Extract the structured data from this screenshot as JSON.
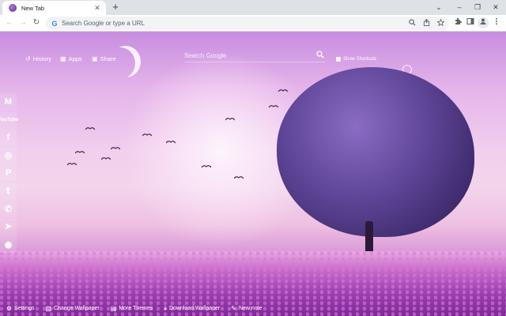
{
  "browser": {
    "tab": {
      "title": "New Tab",
      "close_glyph": "✕"
    },
    "new_tab_glyph": "+",
    "window_controls": {
      "dropdown": "⌄",
      "minimize": "–",
      "restore": "❐",
      "close": "✕"
    },
    "nav": {
      "back": "←",
      "forward": "→",
      "reload": "↻"
    },
    "omnibox": {
      "placeholder": "Search Google or type a URL",
      "g_logo": "G"
    },
    "omnibox_icons": [
      "zoom-icon",
      "share-icon",
      "bookmark-star-icon"
    ],
    "toolbar_icons": [
      "extensions-icon",
      "side-panel-icon",
      "profile-icon",
      "menu-icon"
    ]
  },
  "page": {
    "top_nav": [
      {
        "label": "History",
        "icon": "history-icon",
        "glyph": "↺"
      },
      {
        "label": "Apps",
        "icon": "apps-grid-icon",
        "glyph": "▦"
      },
      {
        "label": "Share",
        "icon": "share-icon",
        "glyph": "▣"
      }
    ],
    "search": {
      "placeholder": "Search Google",
      "icon": "search-icon",
      "glyph": "⌕"
    },
    "shortcuts": {
      "label": "Show Shortcuts"
    },
    "social": [
      {
        "name": "gmail-icon",
        "glyph": "M"
      },
      {
        "name": "youtube-icon",
        "glyph": "YouTube"
      },
      {
        "name": "facebook-icon",
        "glyph": "f"
      },
      {
        "name": "instagram-icon",
        "glyph": "◎"
      },
      {
        "name": "pinterest-icon",
        "glyph": "P"
      },
      {
        "name": "twitter-icon",
        "glyph": "𝕥"
      },
      {
        "name": "whatsapp-icon",
        "glyph": "✆"
      },
      {
        "name": "telegram-icon",
        "glyph": "➤"
      },
      {
        "name": "reddit-icon",
        "glyph": "◉"
      }
    ],
    "bottom_bar": [
      {
        "label": "Settings",
        "icon": "gear-icon",
        "glyph": "⚙"
      },
      {
        "label": "Change Wallpaper",
        "icon": "image-icon",
        "glyph": "▨"
      },
      {
        "label": "More Themes",
        "icon": "themes-icon",
        "glyph": "▤"
      },
      {
        "label": "Download Wallpaper",
        "icon": "download-icon",
        "glyph": "⤓"
      },
      {
        "label": "New note",
        "icon": "note-icon",
        "glyph": "✎"
      }
    ]
  },
  "colors": {
    "chrome_frame": "#dee1e6",
    "accent_purple": "#7e2a97",
    "tree_purple": "#5e4597"
  }
}
